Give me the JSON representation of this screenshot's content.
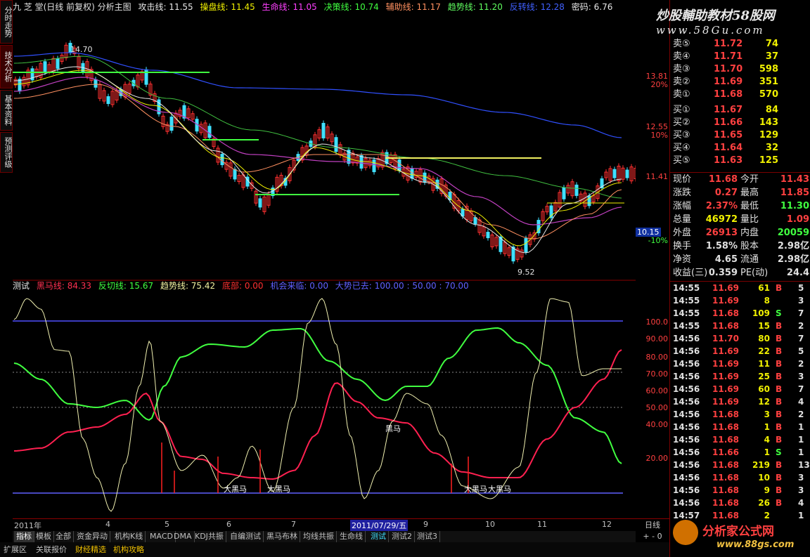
{
  "left_tabs": [
    "分时走势",
    "技术分析",
    "基本资料",
    "预测评级"
  ],
  "header": {
    "title": "九 芝 堂(日线 前复权) 分析主图",
    "items": [
      {
        "label": "攻击线: 11.55",
        "color": "#e8e8e8"
      },
      {
        "label": "操盘线: 11.45",
        "color": "#f0f000"
      },
      {
        "label": "生命线: 11.05",
        "color": "#ff40ff"
      },
      {
        "label": "决策线: 10.74",
        "color": "#40ff40"
      },
      {
        "label": "辅助线: 11.17",
        "color": "#ff9060"
      },
      {
        "label": "趋势线: 11.20",
        "color": "#60ff60"
      },
      {
        "label": "反转线: 12.28",
        "color": "#4060ff"
      },
      {
        "label": "密码: 6.76",
        "color": "#e8e8e8"
      }
    ]
  },
  "price_axis": [
    {
      "label": "13.81",
      "pct": "20%"
    },
    {
      "label": "12.55",
      "pct": "10%"
    },
    {
      "label": "11.41",
      "pct": ""
    },
    {
      "label": "10.15",
      "pct": "-10%"
    }
  ],
  "price_annotations": {
    "high": "14.70",
    "low": "9.52"
  },
  "sub_header": {
    "items": [
      {
        "label": "测试",
        "color": "#e8e8e8"
      },
      {
        "label": "黑马线: 84.33",
        "color": "#ff3050"
      },
      {
        "label": "反切线: 15.67",
        "color": "#40ff40"
      },
      {
        "label": "趋势线: 75.42",
        "color": "#f0f0a0"
      },
      {
        "label": "底部: 0.00",
        "color": "#ff3030"
      },
      {
        "label": "机会来临: 0.00",
        "color": "#6060ff"
      },
      {
        "label": "大势已去: 100.00 : 50.00 : 70.00",
        "color": "#6060ff"
      }
    ]
  },
  "sub_axis": [
    "100.0",
    "90.00",
    "80.00",
    "70.00",
    "60.00",
    "50.00",
    "40.00",
    "20.00"
  ],
  "sub_labels": {
    "black_horse": "黑马",
    "big_black_horse": "大黑马"
  },
  "x_axis": [
    "2011年",
    "4",
    "5",
    "6",
    "7",
    "2011/07/29/五",
    "9",
    "10",
    "11",
    "12"
  ],
  "period": "日线",
  "tabs": [
    "指标",
    "模板",
    "全部",
    "资金异动",
    "机构K线",
    "MACD",
    "DMA",
    "KDJ共振",
    "自编测试",
    "黑马布林",
    "均线共振",
    "生命线",
    "测试",
    "测试2",
    "测试3"
  ],
  "bottom_bar": [
    "扩展区",
    "关联报价",
    "财经精选",
    "机构攻略"
  ],
  "watermark_top": "炒股輔助教材58股网",
  "watermark_url": "www.58Gu.com",
  "watermark_bottom": "分析家公式网",
  "watermark_bottom_url": "www.88gs.com",
  "order_book": [
    {
      "label": "卖⑤",
      "price": "11.72",
      "vol": "74"
    },
    {
      "label": "卖④",
      "price": "11.71",
      "vol": "37"
    },
    {
      "label": "卖③",
      "price": "11.70",
      "vol": "598"
    },
    {
      "label": "卖②",
      "price": "11.69",
      "vol": "351"
    },
    {
      "label": "卖①",
      "price": "11.68",
      "vol": "570"
    },
    {
      "label": "买①",
      "price": "11.67",
      "vol": "84"
    },
    {
      "label": "买②",
      "price": "11.66",
      "vol": "143"
    },
    {
      "label": "买③",
      "price": "11.65",
      "vol": "129"
    },
    {
      "label": "买④",
      "price": "11.64",
      "vol": "32"
    },
    {
      "label": "买⑤",
      "price": "11.63",
      "vol": "125"
    }
  ],
  "stats": [
    {
      "l1": "现价",
      "v1": "11.68",
      "c1": "#ff4040",
      "l2": "今开",
      "v2": "11.43",
      "c2": "#ff4040"
    },
    {
      "l1": "涨跌",
      "v1": "0.27",
      "c1": "#ff4040",
      "l2": "最高",
      "v2": "11.85",
      "c2": "#ff4040"
    },
    {
      "l1": "涨幅",
      "v1": "2.37%",
      "c1": "#ff4040",
      "l2": "最低",
      "v2": "11.30",
      "c2": "#40ff40"
    },
    {
      "l1": "总量",
      "v1": "46972",
      "c1": "#f0f000",
      "l2": "量比",
      "v2": "1.09",
      "c2": "#ff4040"
    },
    {
      "l1": "外盘",
      "v1": "26913",
      "c1": "#ff4040",
      "l2": "内盘",
      "v2": "20059",
      "c2": "#40ff40"
    },
    {
      "l1": "换手",
      "v1": "1.58%",
      "c1": "#e0e0e0",
      "l2": "股本",
      "v2": "2.98亿",
      "c2": "#e0e0e0"
    },
    {
      "l1": "净资",
      "v1": "4.65",
      "c1": "#e0e0e0",
      "l2": "流通",
      "v2": "2.98亿",
      "c2": "#e0e0e0"
    },
    {
      "l1": "收益(三)",
      "v1": "0.359",
      "c1": "#e0e0e0",
      "l2": "PE(动)",
      "v2": "24.4",
      "c2": "#e0e0e0"
    }
  ],
  "trades": [
    {
      "t": "14:55",
      "p": "11.69",
      "v": "61",
      "s": "B",
      "n": "5"
    },
    {
      "t": "14:55",
      "p": "11.69",
      "v": "8",
      "s": "",
      "n": "3"
    },
    {
      "t": "14:55",
      "p": "11.68",
      "v": "109",
      "s": "S",
      "n": "7"
    },
    {
      "t": "14:55",
      "p": "11.68",
      "v": "15",
      "s": "B",
      "n": "2"
    },
    {
      "t": "14:56",
      "p": "11.70",
      "v": "80",
      "s": "B",
      "n": "7"
    },
    {
      "t": "14:56",
      "p": "11.69",
      "v": "22",
      "s": "B",
      "n": "5"
    },
    {
      "t": "14:56",
      "p": "11.69",
      "v": "11",
      "s": "B",
      "n": "2"
    },
    {
      "t": "14:56",
      "p": "11.69",
      "v": "25",
      "s": "B",
      "n": "3"
    },
    {
      "t": "14:56",
      "p": "11.69",
      "v": "60",
      "s": "B",
      "n": "7"
    },
    {
      "t": "14:56",
      "p": "11.69",
      "v": "12",
      "s": "B",
      "n": "4"
    },
    {
      "t": "14:56",
      "p": "11.68",
      "v": "3",
      "s": "B",
      "n": "2"
    },
    {
      "t": "14:56",
      "p": "11.68",
      "v": "1",
      "s": "B",
      "n": "1"
    },
    {
      "t": "14:56",
      "p": "11.68",
      "v": "4",
      "s": "B",
      "n": "1"
    },
    {
      "t": "14:56",
      "p": "11.66",
      "v": "1",
      "s": "S",
      "n": "1"
    },
    {
      "t": "14:56",
      "p": "11.68",
      "v": "219",
      "s": "B",
      "n": "13"
    },
    {
      "t": "14:56",
      "p": "11.68",
      "v": "10",
      "s": "B",
      "n": "3"
    },
    {
      "t": "14:56",
      "p": "11.68",
      "v": "9",
      "s": "B",
      "n": "3"
    },
    {
      "t": "14:56",
      "p": "11.68",
      "v": "26",
      "s": "B",
      "n": "4"
    },
    {
      "t": "14:57",
      "p": "11.68",
      "v": "2",
      "s": "",
      "n": "1"
    }
  ]
}
